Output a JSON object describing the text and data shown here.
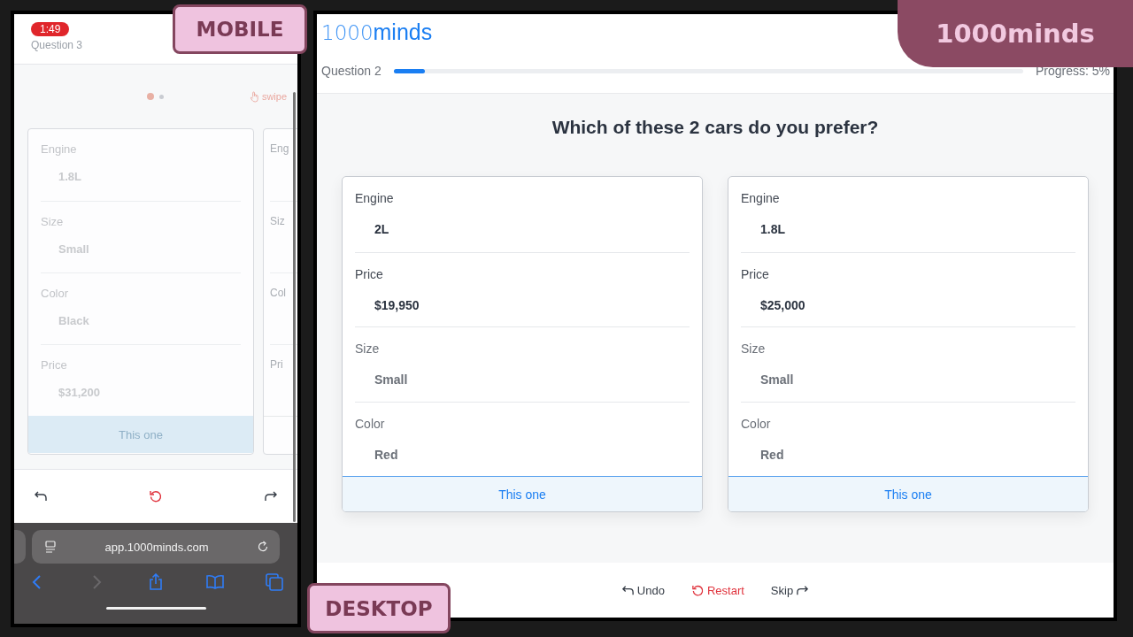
{
  "mobile_badge": "MOBILE",
  "desktop_badge": "DESKTOP",
  "brand_badge": "1000minds",
  "mobile": {
    "status_time": "1:49",
    "question": "Question 3",
    "pager": [
      {
        "selected": true
      },
      {
        "selected": false
      }
    ],
    "swipe_hint": "swipe",
    "card": {
      "attributes": [
        {
          "label": "Engine",
          "value": "1.8L"
        },
        {
          "label": "Size",
          "value": "Small"
        },
        {
          "label": "Color",
          "value": "Black"
        },
        {
          "label": "Price",
          "value": "$31,200"
        }
      ],
      "button": "This one"
    },
    "peek_labels": [
      "Eng",
      "Siz",
      "Col",
      "Pri"
    ],
    "actions": [
      {
        "kind": "undo"
      },
      {
        "kind": "restart"
      },
      {
        "kind": "skip"
      }
    ],
    "url": "app.1000minds.com"
  },
  "desktop": {
    "logo": {
      "light": "1000",
      "bold": "minds"
    },
    "question": "Question 2",
    "progress": {
      "level": 0.05,
      "label": "Progress: 5%"
    },
    "prompt": "Which of these 2 cars do you prefer?",
    "cards": [
      {
        "attributes": [
          {
            "label": "Engine",
            "value": "2L"
          },
          {
            "label": "Price",
            "value": "$19,950"
          },
          {
            "label": "Size",
            "value": "Small"
          },
          {
            "label": "Color",
            "value": "Red"
          }
        ],
        "button": "This one"
      },
      {
        "attributes": [
          {
            "label": "Engine",
            "value": "1.8L"
          },
          {
            "label": "Price",
            "value": "$25,000"
          },
          {
            "label": "Size",
            "value": "Small"
          },
          {
            "label": "Color",
            "value": "Red"
          }
        ],
        "button": "This one"
      }
    ],
    "actions": [
      {
        "kind": "undo",
        "label": "Undo"
      },
      {
        "kind": "restart",
        "label": "Restart"
      },
      {
        "kind": "skip",
        "label": "Skip"
      }
    ]
  }
}
